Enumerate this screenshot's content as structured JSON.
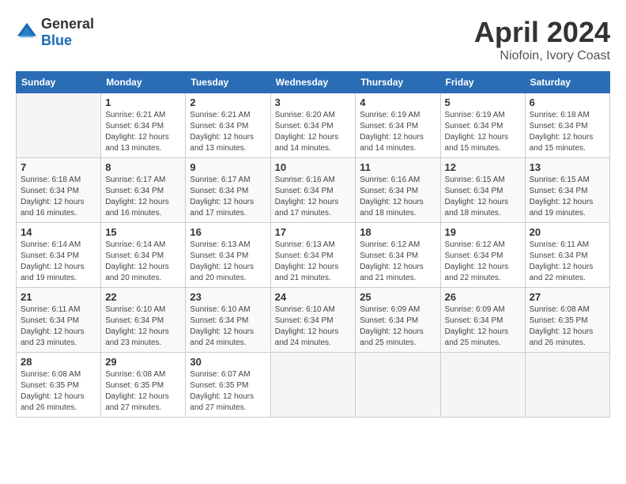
{
  "header": {
    "logo_general": "General",
    "logo_blue": "Blue",
    "month_title": "April 2024",
    "location": "Niofoin, Ivory Coast"
  },
  "days_of_week": [
    "Sunday",
    "Monday",
    "Tuesday",
    "Wednesday",
    "Thursday",
    "Friday",
    "Saturday"
  ],
  "weeks": [
    [
      {
        "day": "",
        "info": ""
      },
      {
        "day": "1",
        "info": "Sunrise: 6:21 AM\nSunset: 6:34 PM\nDaylight: 12 hours\nand 13 minutes."
      },
      {
        "day": "2",
        "info": "Sunrise: 6:21 AM\nSunset: 6:34 PM\nDaylight: 12 hours\nand 13 minutes."
      },
      {
        "day": "3",
        "info": "Sunrise: 6:20 AM\nSunset: 6:34 PM\nDaylight: 12 hours\nand 14 minutes."
      },
      {
        "day": "4",
        "info": "Sunrise: 6:19 AM\nSunset: 6:34 PM\nDaylight: 12 hours\nand 14 minutes."
      },
      {
        "day": "5",
        "info": "Sunrise: 6:19 AM\nSunset: 6:34 PM\nDaylight: 12 hours\nand 15 minutes."
      },
      {
        "day": "6",
        "info": "Sunrise: 6:18 AM\nSunset: 6:34 PM\nDaylight: 12 hours\nand 15 minutes."
      }
    ],
    [
      {
        "day": "7",
        "info": "Sunrise: 6:18 AM\nSunset: 6:34 PM\nDaylight: 12 hours\nand 16 minutes."
      },
      {
        "day": "8",
        "info": "Sunrise: 6:17 AM\nSunset: 6:34 PM\nDaylight: 12 hours\nand 16 minutes."
      },
      {
        "day": "9",
        "info": "Sunrise: 6:17 AM\nSunset: 6:34 PM\nDaylight: 12 hours\nand 17 minutes."
      },
      {
        "day": "10",
        "info": "Sunrise: 6:16 AM\nSunset: 6:34 PM\nDaylight: 12 hours\nand 17 minutes."
      },
      {
        "day": "11",
        "info": "Sunrise: 6:16 AM\nSunset: 6:34 PM\nDaylight: 12 hours\nand 18 minutes."
      },
      {
        "day": "12",
        "info": "Sunrise: 6:15 AM\nSunset: 6:34 PM\nDaylight: 12 hours\nand 18 minutes."
      },
      {
        "day": "13",
        "info": "Sunrise: 6:15 AM\nSunset: 6:34 PM\nDaylight: 12 hours\nand 19 minutes."
      }
    ],
    [
      {
        "day": "14",
        "info": "Sunrise: 6:14 AM\nSunset: 6:34 PM\nDaylight: 12 hours\nand 19 minutes."
      },
      {
        "day": "15",
        "info": "Sunrise: 6:14 AM\nSunset: 6:34 PM\nDaylight: 12 hours\nand 20 minutes."
      },
      {
        "day": "16",
        "info": "Sunrise: 6:13 AM\nSunset: 6:34 PM\nDaylight: 12 hours\nand 20 minutes."
      },
      {
        "day": "17",
        "info": "Sunrise: 6:13 AM\nSunset: 6:34 PM\nDaylight: 12 hours\nand 21 minutes."
      },
      {
        "day": "18",
        "info": "Sunrise: 6:12 AM\nSunset: 6:34 PM\nDaylight: 12 hours\nand 21 minutes."
      },
      {
        "day": "19",
        "info": "Sunrise: 6:12 AM\nSunset: 6:34 PM\nDaylight: 12 hours\nand 22 minutes."
      },
      {
        "day": "20",
        "info": "Sunrise: 6:11 AM\nSunset: 6:34 PM\nDaylight: 12 hours\nand 22 minutes."
      }
    ],
    [
      {
        "day": "21",
        "info": "Sunrise: 6:11 AM\nSunset: 6:34 PM\nDaylight: 12 hours\nand 23 minutes."
      },
      {
        "day": "22",
        "info": "Sunrise: 6:10 AM\nSunset: 6:34 PM\nDaylight: 12 hours\nand 23 minutes."
      },
      {
        "day": "23",
        "info": "Sunrise: 6:10 AM\nSunset: 6:34 PM\nDaylight: 12 hours\nand 24 minutes."
      },
      {
        "day": "24",
        "info": "Sunrise: 6:10 AM\nSunset: 6:34 PM\nDaylight: 12 hours\nand 24 minutes."
      },
      {
        "day": "25",
        "info": "Sunrise: 6:09 AM\nSunset: 6:34 PM\nDaylight: 12 hours\nand 25 minutes."
      },
      {
        "day": "26",
        "info": "Sunrise: 6:09 AM\nSunset: 6:34 PM\nDaylight: 12 hours\nand 25 minutes."
      },
      {
        "day": "27",
        "info": "Sunrise: 6:08 AM\nSunset: 6:35 PM\nDaylight: 12 hours\nand 26 minutes."
      }
    ],
    [
      {
        "day": "28",
        "info": "Sunrise: 6:08 AM\nSunset: 6:35 PM\nDaylight: 12 hours\nand 26 minutes."
      },
      {
        "day": "29",
        "info": "Sunrise: 6:08 AM\nSunset: 6:35 PM\nDaylight: 12 hours\nand 27 minutes."
      },
      {
        "day": "30",
        "info": "Sunrise: 6:07 AM\nSunset: 6:35 PM\nDaylight: 12 hours\nand 27 minutes."
      },
      {
        "day": "",
        "info": ""
      },
      {
        "day": "",
        "info": ""
      },
      {
        "day": "",
        "info": ""
      },
      {
        "day": "",
        "info": ""
      }
    ]
  ]
}
